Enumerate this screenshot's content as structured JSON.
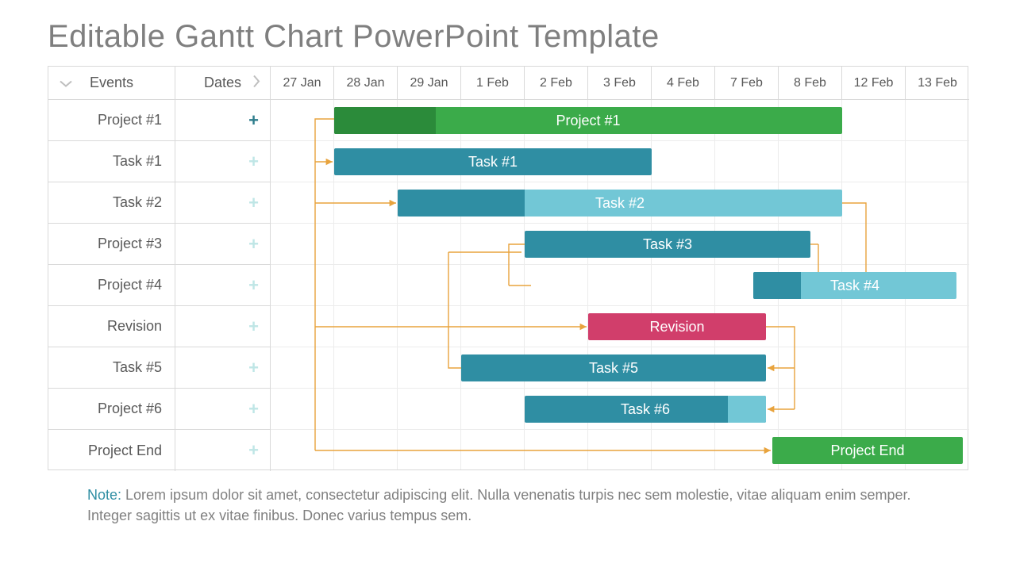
{
  "title": "Editable Gantt Chart PowerPoint Template",
  "columns": {
    "events": "Events",
    "dates": "Dates"
  },
  "timeline": [
    "27 Jan",
    "28 Jan",
    "29 Jan",
    "1 Feb",
    "2 Feb",
    "3 Feb",
    "4 Feb",
    "7 Feb",
    "8 Feb",
    "12 Feb",
    "13 Feb"
  ],
  "rows": [
    {
      "label": "Project #1",
      "plus": "strong"
    },
    {
      "label": "Task #1",
      "plus": "light"
    },
    {
      "label": "Task #2",
      "plus": "light"
    },
    {
      "label": "Project #3",
      "plus": "light"
    },
    {
      "label": "Project #4",
      "plus": "light"
    },
    {
      "label": "Revision",
      "plus": "light"
    },
    {
      "label": "Task #5",
      "plus": "light"
    },
    {
      "label": "Project #6",
      "plus": "light"
    },
    {
      "label": "Project End",
      "plus": "light"
    }
  ],
  "bars": [
    {
      "row": 0,
      "label": "Project #1",
      "start": 1,
      "span": 8,
      "color": "green",
      "progress_cols": 1.6,
      "progress_color": "green-dark"
    },
    {
      "row": 1,
      "label": "Task #1",
      "start": 1,
      "span": 5,
      "color": "teal"
    },
    {
      "row": 2,
      "label": "Task #2",
      "start": 2,
      "span": 7,
      "color": "teal-light",
      "progress_cols": 2,
      "progress_color": "teal"
    },
    {
      "row": 3,
      "label": "Task #3",
      "start": 4,
      "span": 4.5,
      "color": "teal"
    },
    {
      "row": 4,
      "label": "Task #4",
      "start": 7.6,
      "span": 3.2,
      "color": "teal-light",
      "progress_cols": 0.75,
      "progress_color": "teal"
    },
    {
      "row": 5,
      "label": "Revision",
      "start": 5,
      "span": 2.8,
      "color": "pink"
    },
    {
      "row": 6,
      "label": "Task #5",
      "start": 3,
      "span": 4.8,
      "color": "teal"
    },
    {
      "row": 7,
      "label": "Task #6",
      "start": 4,
      "span": 3.8,
      "color": "teal",
      "tail_cols": 0.6,
      "tail_color": "teal-light"
    },
    {
      "row": 8,
      "label": "Project End",
      "start": 7.9,
      "span": 3,
      "color": "green"
    }
  ],
  "note_label": "Note:",
  "note_text": " Lorem ipsum dolor sit amet, consectetur adipiscing elit. Nulla venenatis turpis nec sem molestie, vitae aliquam enim semper. Integer sagittis ut ex vitae finibus. Donec varius tempus sem.",
  "chart_data": {
    "type": "gantt",
    "title": "Editable Gantt Chart PowerPoint Template",
    "x_categories": [
      "27 Jan",
      "28 Jan",
      "29 Jan",
      "1 Feb",
      "2 Feb",
      "3 Feb",
      "4 Feb",
      "7 Feb",
      "8 Feb",
      "12 Feb",
      "13 Feb"
    ],
    "tasks": [
      {
        "row_label": "Project #1",
        "bar_label": "Project #1",
        "start": "28 Jan",
        "end": "8 Feb",
        "progress_pct": 20,
        "color": "green"
      },
      {
        "row_label": "Task #1",
        "bar_label": "Task #1",
        "start": "28 Jan",
        "end": "3 Feb",
        "color": "teal"
      },
      {
        "row_label": "Task #2",
        "bar_label": "Task #2",
        "start": "29 Jan",
        "end": "8 Feb",
        "progress_pct": 29,
        "color": "teal-light"
      },
      {
        "row_label": "Project #3",
        "bar_label": "Task #3",
        "start": "2 Feb",
        "end": "7 Feb",
        "color": "teal"
      },
      {
        "row_label": "Project #4",
        "bar_label": "Task #4",
        "start": "7 Feb",
        "end": "13 Feb",
        "progress_pct": 23,
        "color": "teal-light"
      },
      {
        "row_label": "Revision",
        "bar_label": "Revision",
        "start": "3 Feb",
        "end": "7 Feb",
        "color": "pink"
      },
      {
        "row_label": "Task #5",
        "bar_label": "Task #5",
        "start": "1 Feb",
        "end": "7 Feb",
        "color": "teal"
      },
      {
        "row_label": "Project #6",
        "bar_label": "Task #6",
        "start": "2 Feb",
        "end": "7 Feb",
        "color": "teal"
      },
      {
        "row_label": "Project End",
        "bar_label": "Project End",
        "start": "7 Feb",
        "end": "13 Feb",
        "color": "green"
      }
    ],
    "dependencies": [
      [
        "Project #1",
        "Task #1"
      ],
      [
        "Project #1",
        "Task #2"
      ],
      [
        "Project #1",
        "Revision"
      ],
      [
        "Project #1",
        "Project End"
      ],
      [
        "Task #2",
        "Task #4"
      ],
      [
        "Task #3",
        "Task #4"
      ],
      [
        "Revision",
        "Task #5"
      ],
      [
        "Revision",
        "Task #6"
      ],
      [
        "Task #5",
        "Task #3"
      ]
    ]
  }
}
